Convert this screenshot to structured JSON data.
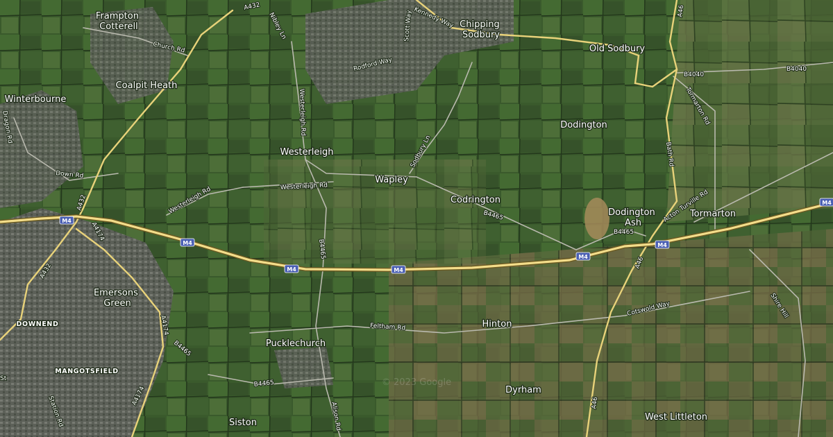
{
  "map": {
    "style": "satellite",
    "watermark": "© 2023 Google",
    "colors": {
      "base": "#2f4a26",
      "motorway": "#f3dd8a",
      "major_road": "#e8d27a",
      "minor_road": "#b8b8b0",
      "shield": "#4a5fb3",
      "urban": "#5d6158"
    },
    "places": [
      {
        "id": "frampton-cotterell",
        "lines": [
          "Frampton",
          "Cotterell"
        ]
      },
      {
        "id": "coalpit-heath",
        "lines": [
          "Coalpit Heath"
        ]
      },
      {
        "id": "winterbourne",
        "lines": [
          "Winterbourne"
        ]
      },
      {
        "id": "chipping-sodbury",
        "lines": [
          "Chipping",
          "Sodbury"
        ]
      },
      {
        "id": "old-sodbury",
        "lines": [
          "Old Sodbury"
        ]
      },
      {
        "id": "dodington",
        "lines": [
          "Dodington"
        ]
      },
      {
        "id": "westerleigh",
        "lines": [
          "Westerleigh"
        ]
      },
      {
        "id": "wapley",
        "lines": [
          "Wapley"
        ]
      },
      {
        "id": "codrington",
        "lines": [
          "Codrington"
        ]
      },
      {
        "id": "dodington-ash",
        "lines": [
          "Dodington",
          "Ash"
        ]
      },
      {
        "id": "tormarton",
        "lines": [
          "Tormarton"
        ]
      },
      {
        "id": "emersons-green",
        "lines": [
          "Emersons",
          "Green"
        ]
      },
      {
        "id": "downend",
        "lines": [
          "DOWNEND"
        ]
      },
      {
        "id": "mangotsfield",
        "lines": [
          "MANGOTSFIELD"
        ]
      },
      {
        "id": "pucklechurch",
        "lines": [
          "Pucklechurch"
        ]
      },
      {
        "id": "hinton",
        "lines": [
          "Hinton"
        ]
      },
      {
        "id": "dyrham",
        "lines": [
          "Dyrham"
        ]
      },
      {
        "id": "siston",
        "lines": [
          "Siston"
        ]
      },
      {
        "id": "west-littleton",
        "lines": [
          "West Littleton"
        ]
      }
    ],
    "road_labels": [
      {
        "id": "a432-top",
        "text": "A432"
      },
      {
        "id": "nibley-ln",
        "text": "Nibley Ln"
      },
      {
        "id": "kennedy-way",
        "text": "Kennedy Way"
      },
      {
        "id": "scott-way",
        "text": "Scott Way"
      },
      {
        "id": "rodford-way",
        "text": "Rodford Way"
      },
      {
        "id": "a46-top",
        "text": "A46"
      },
      {
        "id": "church-rd",
        "text": "Church Rd"
      },
      {
        "id": "b4040-a",
        "text": "B4040"
      },
      {
        "id": "b4040-b",
        "text": "B4040"
      },
      {
        "id": "tormarton-rd",
        "text": "Tormarton Rd"
      },
      {
        "id": "dragon-rd",
        "text": "Dragon Rd"
      },
      {
        "id": "westerleigh-rd-n",
        "text": "Westerleigh Rd"
      },
      {
        "id": "bath-rd",
        "text": "Bath Rd"
      },
      {
        "id": "down-rd",
        "text": "Down Rd"
      },
      {
        "id": "sodbury-ln",
        "text": "Sodbury Ln"
      },
      {
        "id": "westerleigh-rd-e",
        "text": "Westerleigh Rd"
      },
      {
        "id": "westerleigh-rd-w",
        "text": "Westerleigh Rd"
      },
      {
        "id": "a432-mid",
        "text": "A432"
      },
      {
        "id": "acton-turville-rd",
        "text": "Acton Turville Rd"
      },
      {
        "id": "b4465-codrington",
        "text": "B4465"
      },
      {
        "id": "b4465-ash",
        "text": "B4465"
      },
      {
        "id": "a4174-n",
        "text": "A4174"
      },
      {
        "id": "b4465-vert",
        "text": "B4465"
      },
      {
        "id": "a432-sw",
        "text": "A432"
      },
      {
        "id": "a46-mid",
        "text": "A46"
      },
      {
        "id": "shire-hill",
        "text": "Shire Hill"
      },
      {
        "id": "cotswold-way",
        "text": "Cotswold Way"
      },
      {
        "id": "feltham-rd",
        "text": "Feltham Rd"
      },
      {
        "id": "a4174-mid",
        "text": "A4174"
      },
      {
        "id": "b4465-sw",
        "text": "B4465"
      },
      {
        "id": "b4465-puck",
        "text": "B4465"
      },
      {
        "id": "a4174-s",
        "text": "A4174"
      },
      {
        "id": "station-rd",
        "text": "Station Rd"
      },
      {
        "id": "alison-rd",
        "text": "Alison Rd"
      },
      {
        "id": "a46-s",
        "text": "A46"
      },
      {
        "id": "st",
        "text": "St"
      }
    ],
    "shields": [
      {
        "id": "m4-west",
        "text": "M4"
      },
      {
        "id": "m4-a",
        "text": "M4"
      },
      {
        "id": "m4-b",
        "text": "M4"
      },
      {
        "id": "m4-c",
        "text": "M4"
      },
      {
        "id": "m4-d",
        "text": "M4"
      },
      {
        "id": "m4-e",
        "text": "M4"
      },
      {
        "id": "m4-east",
        "text": "M4"
      }
    ]
  }
}
